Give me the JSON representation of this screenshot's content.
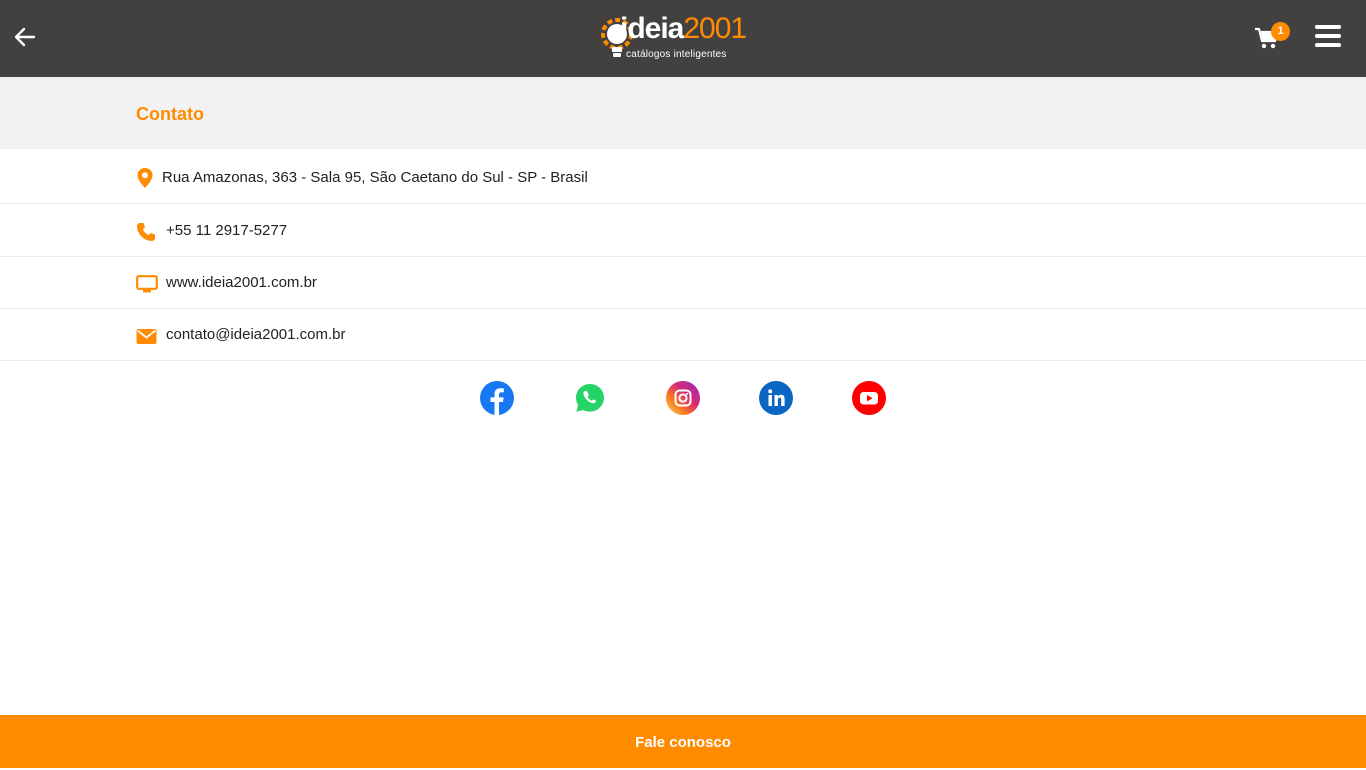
{
  "header": {
    "logo_word": "ideia",
    "logo_number": "2001",
    "logo_tagline": "catálogos inteligentes",
    "cart_count": "1",
    "back_icon": "arrow-left-icon",
    "cart_icon": "cart-icon",
    "menu_icon": "hamburger-menu-icon"
  },
  "page": {
    "title": "Contato"
  },
  "contact": {
    "address": "Rua Amazonas, 363 - Sala 95, São Caetano do Sul - SP - Brasil",
    "phone": "+55 11 2917-5277",
    "website": "www.ideia2001.com.br",
    "email": "contato@ideia2001.com.br"
  },
  "social": [
    "facebook-icon",
    "whatsapp-icon",
    "instagram-icon",
    "linkedin-icon",
    "youtube-icon"
  ],
  "footer": {
    "cta_label": "Fale conosco"
  },
  "colors": {
    "accent": "#ff8c00",
    "topbar": "#434040",
    "header_band": "#f2f2f2"
  }
}
